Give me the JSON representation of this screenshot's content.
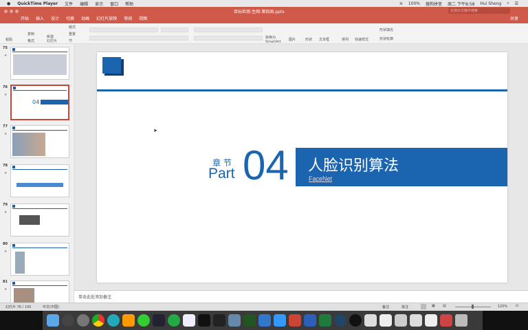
{
  "menubar": {
    "app": "QuickTime Player",
    "items": [
      "文件",
      "编辑",
      "显示",
      "窗口",
      "帮助"
    ],
    "battery": "100%",
    "ime": "搜狗拼音",
    "clock": "周二 下午8:58",
    "user": "Hui Sheng"
  },
  "window": {
    "title": "目标检测-生网-第四周.pptx",
    "search_placeholder": "在演示文稿中搜索",
    "share": "共享"
  },
  "tabs": [
    "开始",
    "插入",
    "设计",
    "切换",
    "动画",
    "幻灯片放映",
    "审阅",
    "视图"
  ],
  "ribbon": {
    "paste": "粘贴",
    "copy": "复制",
    "format": "格式",
    "new_slide": "新建\n幻灯片",
    "layout": "版式",
    "reset": "重置",
    "section": "节",
    "convert": "转换为\nSmartArt",
    "picture": "图片",
    "shape": "形状",
    "textbox": "文本框",
    "arrange": "排列",
    "quick_styles": "快速样式",
    "shape_fill": "形状填充",
    "shape_outline": "形状轮廓"
  },
  "thumbnails": [
    {
      "num": "75"
    },
    {
      "num": "76",
      "selected": true,
      "mini_num": "04"
    },
    {
      "num": "77"
    },
    {
      "num": "78"
    },
    {
      "num": "79"
    },
    {
      "num": "80"
    },
    {
      "num": "81"
    }
  ],
  "slide": {
    "chapter": "章 节",
    "part": "Part",
    "number": "04",
    "title": "人脸识别算法",
    "subtitle": "FaceNet",
    "accent": "#1b64b0"
  },
  "notes": {
    "placeholder": "单击此处添加备注"
  },
  "status": {
    "slide": "幻灯片 76 / 100",
    "lang": "中文(中国)",
    "notes": "备注",
    "comments": "批注",
    "zoom": "120%"
  }
}
